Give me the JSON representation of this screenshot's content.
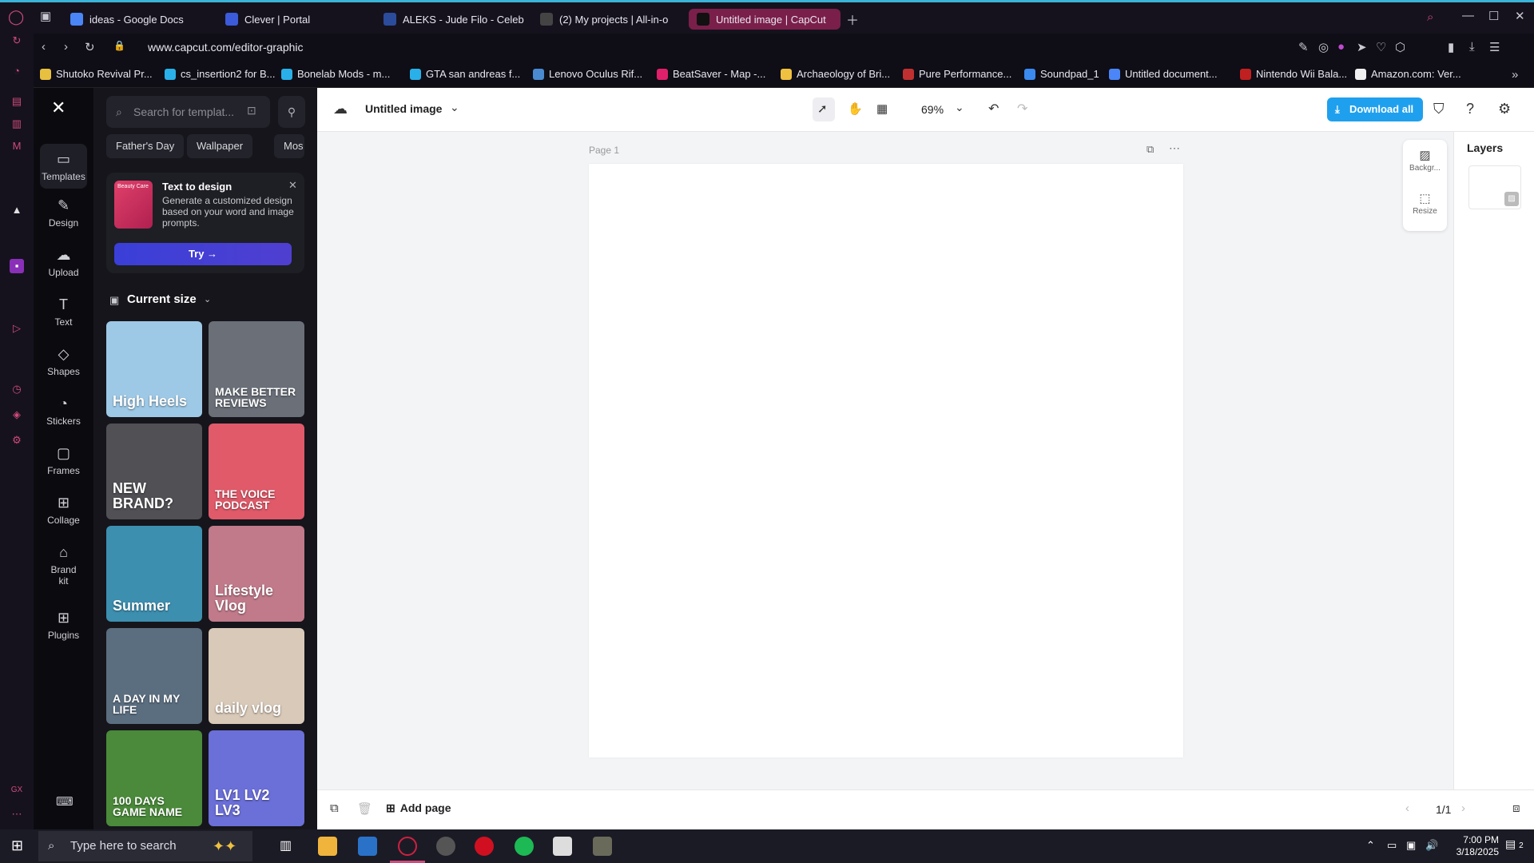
{
  "browser": {
    "tabs": [
      {
        "label": "ideas - Google Docs",
        "color": "#4a86f7"
      },
      {
        "label": "Clever | Portal",
        "color": "#3b5bdb"
      },
      {
        "label": "ALEKS - Jude Filo - Celeb",
        "color": "#2b4c9b"
      },
      {
        "label": "(2) My projects | All-in-o",
        "color": "#444"
      },
      {
        "label": "Untitled image | CapCut",
        "color": "#111"
      }
    ],
    "url": "www.capcut.com/editor-graphic",
    "bookmarks": [
      "Shutoko Revival Pr...",
      "cs_insertion2 for B...",
      "Bonelab Mods - m...",
      "GTA san andreas f...",
      "Lenovo Oculus Rif...",
      "BeatSaver - Map -...",
      "Archaeology of Bri...",
      "Pure Performance...",
      "Soundpad_1",
      "Untitled document...",
      "Nintendo Wii Bala...",
      "Amazon.com: Ver..."
    ]
  },
  "capcut": {
    "rail": [
      {
        "label": "Templates",
        "icon": "templates-icon"
      },
      {
        "label": "Design",
        "icon": "design-icon"
      },
      {
        "label": "Upload",
        "icon": "upload-icon"
      },
      {
        "label": "Text",
        "icon": "text-icon"
      },
      {
        "label": "Shapes",
        "icon": "shapes-icon"
      },
      {
        "label": "Stickers",
        "icon": "stickers-icon"
      },
      {
        "label": "Frames",
        "icon": "frames-icon"
      },
      {
        "label": "Collage",
        "icon": "collage-icon"
      },
      {
        "label": "Brand kit",
        "icon": "brand-kit-icon"
      },
      {
        "label": "Plugins",
        "icon": "plugins-icon"
      }
    ],
    "search_placeholder": "Search for templat...",
    "chips": [
      "Father's Day",
      "Wallpaper",
      "Mos"
    ],
    "promo": {
      "title": "Text to design",
      "body": "Generate a customized design based on your word and image prompts.",
      "try_label": "Try →",
      "thumb_text": "Beauty Care"
    },
    "size_label": "Current size",
    "templates": [
      {
        "text": "High Heels",
        "bg": "#9ec9e6"
      },
      {
        "text": "MAKE BETTER REVIEWS",
        "bg": "#6a6f78"
      },
      {
        "text": "NEW BRAND?",
        "bg": "#505055"
      },
      {
        "text": "THE VOICE PODCAST",
        "bg": "#e05a6a"
      },
      {
        "text": "Summer",
        "bg": "#3d8fb0"
      },
      {
        "text": "Lifestyle Vlog",
        "bg": "#c07a8a"
      },
      {
        "text": "A DAY IN MY LIFE",
        "bg": "#5b6e80"
      },
      {
        "text": "daily vlog",
        "bg": "#d9c9b8"
      },
      {
        "text": "100 DAYS GAME NAME",
        "bg": "#4a8a3a"
      },
      {
        "text": "LV1 LV2 LV3",
        "bg": "#6b6fd8"
      }
    ],
    "doc_title": "Untitled image",
    "zoom": "69%",
    "download_label": "Download all",
    "page_label": "Page 1",
    "side_tools": [
      "Backgr...",
      "Resize"
    ],
    "layers_title": "Layers",
    "add_page_label": "Add page",
    "page_count": "1/1"
  },
  "taskbar": {
    "search_placeholder": "Type here to search",
    "time": "7:00 PM",
    "date": "3/18/2025",
    "notif_count": "2"
  }
}
